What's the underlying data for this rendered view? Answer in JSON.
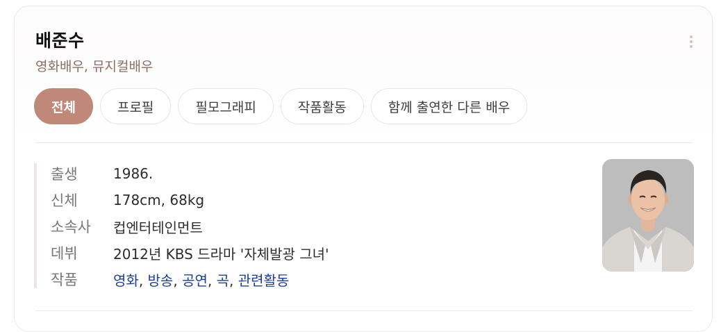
{
  "profile": {
    "name": "배준수",
    "occupation": "영화배우, 뮤지컬배우"
  },
  "menu": {
    "icon": "more-vertical-icon"
  },
  "tabs": [
    {
      "label": "전체",
      "active": true
    },
    {
      "label": "프로필",
      "active": false
    },
    {
      "label": "필모그래피",
      "active": false
    },
    {
      "label": "작품활동",
      "active": false
    },
    {
      "label": "함께 출연한 다른 배우",
      "active": false
    }
  ],
  "info": {
    "birth": {
      "label": "출생",
      "value": "1986."
    },
    "body": {
      "label": "신체",
      "value": "178cm, 68kg"
    },
    "agency": {
      "label": "소속사",
      "value": "컵엔터테인먼트"
    },
    "debut": {
      "label": "데뷔",
      "value": "2012년 KBS 드라마 '자체발광 그녀'"
    },
    "works": {
      "label": "작품",
      "links": [
        "영화",
        "방송",
        "공연",
        "곡",
        "관련활동"
      ],
      "separator": ", "
    }
  },
  "colors": {
    "accent": "#c08878",
    "link": "#1a3f9c",
    "subtitle": "#8a6e66"
  }
}
